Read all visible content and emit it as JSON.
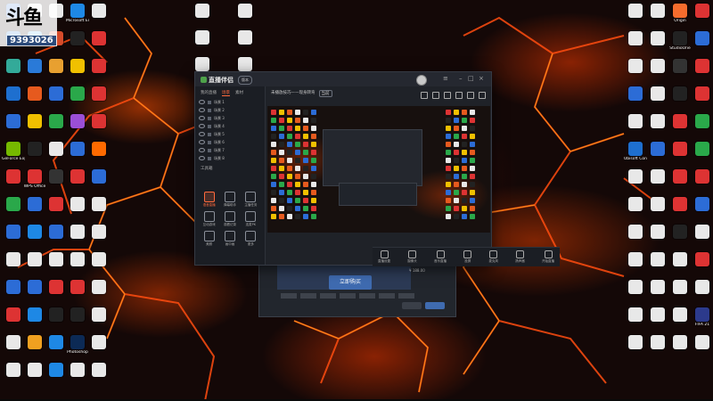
{
  "watermark": {
    "logo": "斗鱼",
    "number": "9393026"
  },
  "desktop": {
    "left_icons": [
      {
        "label": "",
        "color": "#2c6cd6"
      },
      {
        "label": "",
        "color": "#e8e8e8"
      },
      {
        "label": "",
        "color": "#e8e8e8"
      },
      {
        "label": "Microsoft Edge",
        "color": "#1e88e5"
      },
      {
        "label": "",
        "color": "#e8e8e8"
      },
      {
        "label": "",
        "color": "#2a7ad8"
      },
      {
        "label": "",
        "color": "#54b4f0"
      },
      {
        "label": "",
        "color": "#d64b2a"
      },
      {
        "label": "",
        "color": "#222"
      },
      {
        "label": "",
        "color": "#d33"
      },
      {
        "label": "",
        "color": "#3a9"
      },
      {
        "label": "",
        "color": "#2a7ad8"
      },
      {
        "label": "",
        "color": "#e8a030"
      },
      {
        "label": "",
        "color": "#f0c000"
      },
      {
        "label": "",
        "color": "#d33"
      },
      {
        "label": "",
        "color": "#1e6fcf"
      },
      {
        "label": "",
        "color": "#e65a1e"
      },
      {
        "label": "",
        "color": "#2c6cd6"
      },
      {
        "label": "",
        "color": "#2aa84a"
      },
      {
        "label": "",
        "color": "#d33"
      },
      {
        "label": "",
        "color": "#2c6cd6"
      },
      {
        "label": "",
        "color": "#f0c000"
      },
      {
        "label": "",
        "color": "#2aa84a"
      },
      {
        "label": "",
        "color": "#9b4fd6"
      },
      {
        "label": "",
        "color": "#d33"
      },
      {
        "label": "GeForce Experience",
        "color": "#76b900"
      },
      {
        "label": "",
        "color": "#222"
      },
      {
        "label": "",
        "color": "#e8e8e8"
      },
      {
        "label": "",
        "color": "#2c6cd6"
      },
      {
        "label": "",
        "color": "#ff6a00"
      },
      {
        "label": "",
        "color": "#d33"
      },
      {
        "label": "WPS Office",
        "color": "#d33"
      },
      {
        "label": "",
        "color": "#333"
      },
      {
        "label": "",
        "color": "#d33"
      },
      {
        "label": "",
        "color": "#2c6cd6"
      },
      {
        "label": "",
        "color": "#2aa84a"
      },
      {
        "label": "",
        "color": "#2c6cd6"
      },
      {
        "label": "",
        "color": "#d33"
      },
      {
        "label": "",
        "color": "#e8e8e8"
      },
      {
        "label": "",
        "color": "#e8e8e8"
      },
      {
        "label": "",
        "color": "#2c6cd6"
      },
      {
        "label": "",
        "color": "#1e88e5"
      },
      {
        "label": "",
        "color": "#2c6cd6"
      },
      {
        "label": "",
        "color": "#e8e8e8"
      },
      {
        "label": "",
        "color": "#e8e8e8"
      },
      {
        "label": "",
        "color": "#e8e8e8"
      },
      {
        "label": "",
        "color": "#e8e8e8"
      },
      {
        "label": "",
        "color": "#e8e8e8"
      },
      {
        "label": "",
        "color": "#e8e8e8"
      },
      {
        "label": "",
        "color": "#e8e8e8"
      },
      {
        "label": "",
        "color": "#2c6cd6"
      },
      {
        "label": "",
        "color": "#2c6cd6"
      },
      {
        "label": "",
        "color": "#d33"
      },
      {
        "label": "",
        "color": "#d33"
      },
      {
        "label": "",
        "color": "#e8e8e8"
      },
      {
        "label": "",
        "color": "#d33"
      },
      {
        "label": "",
        "color": "#1e88e5"
      },
      {
        "label": "",
        "color": "#222"
      },
      {
        "label": "",
        "color": "#222"
      },
      {
        "label": "",
        "color": "#e8e8e8"
      },
      {
        "label": "",
        "color": "#e8e8e8"
      },
      {
        "label": "",
        "color": "#f0a020"
      },
      {
        "label": "",
        "color": "#1e88e5"
      },
      {
        "label": "Photoshop",
        "color": "#0c2a55"
      },
      {
        "label": "",
        "color": "#e8e8e8"
      },
      {
        "label": "",
        "color": "#e8e8e8"
      },
      {
        "label": "",
        "color": "#e8e8e8"
      },
      {
        "label": "",
        "color": "#1e88e5"
      },
      {
        "label": "",
        "color": "#e8e8e8"
      },
      {
        "label": "",
        "color": "#e8e8e8"
      }
    ],
    "mid_icons": [
      {
        "label": "",
        "color": "#e8e8e8"
      },
      {
        "label": "",
        "color": "#e8e8e8"
      },
      {
        "label": "",
        "color": "#e8e8e8"
      },
      {
        "label": "",
        "color": "#e8e8e8"
      },
      {
        "label": "",
        "color": "#e8e8e8"
      },
      {
        "label": "",
        "color": "#e8e8e8"
      }
    ],
    "right_icons": [
      {
        "label": "",
        "color": "#e8e8e8"
      },
      {
        "label": "",
        "color": "#e8e8e8"
      },
      {
        "label": "Origin",
        "color": "#f56c2d"
      },
      {
        "label": "",
        "color": "#d33"
      },
      {
        "label": "",
        "color": "#e8e8e8"
      },
      {
        "label": "",
        "color": "#e8e8e8"
      },
      {
        "label": "StudioOne",
        "color": "#222"
      },
      {
        "label": "",
        "color": "#2c6cd6"
      },
      {
        "label": "",
        "color": "#e8e8e8"
      },
      {
        "label": "",
        "color": "#e8e8e8"
      },
      {
        "label": "",
        "color": "#333"
      },
      {
        "label": "",
        "color": "#d33"
      },
      {
        "label": "",
        "color": "#2c6cd6"
      },
      {
        "label": "",
        "color": "#e8e8e8"
      },
      {
        "label": "",
        "color": "#222"
      },
      {
        "label": "",
        "color": "#d33"
      },
      {
        "label": "",
        "color": "#e8e8e8"
      },
      {
        "label": "",
        "color": "#e8e8e8"
      },
      {
        "label": "",
        "color": "#d33"
      },
      {
        "label": "",
        "color": "#2aa84a"
      },
      {
        "label": "Ubisoft Connect",
        "color": "#1e6fcf"
      },
      {
        "label": "",
        "color": "#2c6cd6"
      },
      {
        "label": "",
        "color": "#d33"
      },
      {
        "label": "",
        "color": "#2aa84a"
      },
      {
        "label": "",
        "color": "#e8e8e8"
      },
      {
        "label": "",
        "color": "#e8e8e8"
      },
      {
        "label": "",
        "color": "#d33"
      },
      {
        "label": "",
        "color": "#d33"
      },
      {
        "label": "",
        "color": "#e8e8e8"
      },
      {
        "label": "",
        "color": "#e8e8e8"
      },
      {
        "label": "",
        "color": "#d33"
      },
      {
        "label": "",
        "color": "#2c6cd6"
      },
      {
        "label": "",
        "color": "#e8e8e8"
      },
      {
        "label": "",
        "color": "#e8e8e8"
      },
      {
        "label": "",
        "color": "#222"
      },
      {
        "label": "",
        "color": "#e8e8e8"
      },
      {
        "label": "",
        "color": "#e8e8e8"
      },
      {
        "label": "",
        "color": "#e8e8e8"
      },
      {
        "label": "",
        "color": "#e8e8e8"
      },
      {
        "label": "",
        "color": "#d33"
      },
      {
        "label": "",
        "color": "#e8e8e8"
      },
      {
        "label": "",
        "color": "#e8e8e8"
      },
      {
        "label": "",
        "color": "#e8e8e8"
      },
      {
        "label": "",
        "color": "#e8e8e8"
      },
      {
        "label": "",
        "color": "#e8e8e8"
      },
      {
        "label": "",
        "color": "#e8e8e8"
      },
      {
        "label": "",
        "color": "#e8e8e8"
      },
      {
        "label": "FIFA 21",
        "color": "#2c3a8c"
      },
      {
        "label": "",
        "color": "#e8e8e8"
      },
      {
        "label": "",
        "color": "#e8e8e8"
      },
      {
        "label": "",
        "color": "#e8e8e8"
      },
      {
        "label": "",
        "color": "#e8e8e8"
      }
    ]
  },
  "app": {
    "brand": "直播伴侣",
    "version": "版本",
    "tabs": [
      "我的直播",
      "场景",
      "素材"
    ],
    "scenes": [
      "场景 1",
      "场景 2",
      "场景 3",
      "场景 4",
      "场景 5",
      "场景 6",
      "场景 7",
      "场景 8"
    ],
    "tools_title": "工具箱",
    "tools": [
      "语音直播",
      "弹幕助手",
      "主播任务",
      "互动游戏",
      "观看记录",
      "连麦PK",
      "美颜",
      "画中画",
      "更多"
    ],
    "footer": "",
    "main_title": "未播放技巧——现身转弯",
    "main_tag": "当前",
    "bottom_buttons": [
      "直播设置",
      "摄像头",
      "音乐直播",
      "投屏",
      "麦克风",
      "扬声器",
      "开始直播"
    ]
  },
  "purchase": {
    "buy_label": "立即购买",
    "price": "¥ 188.00"
  }
}
